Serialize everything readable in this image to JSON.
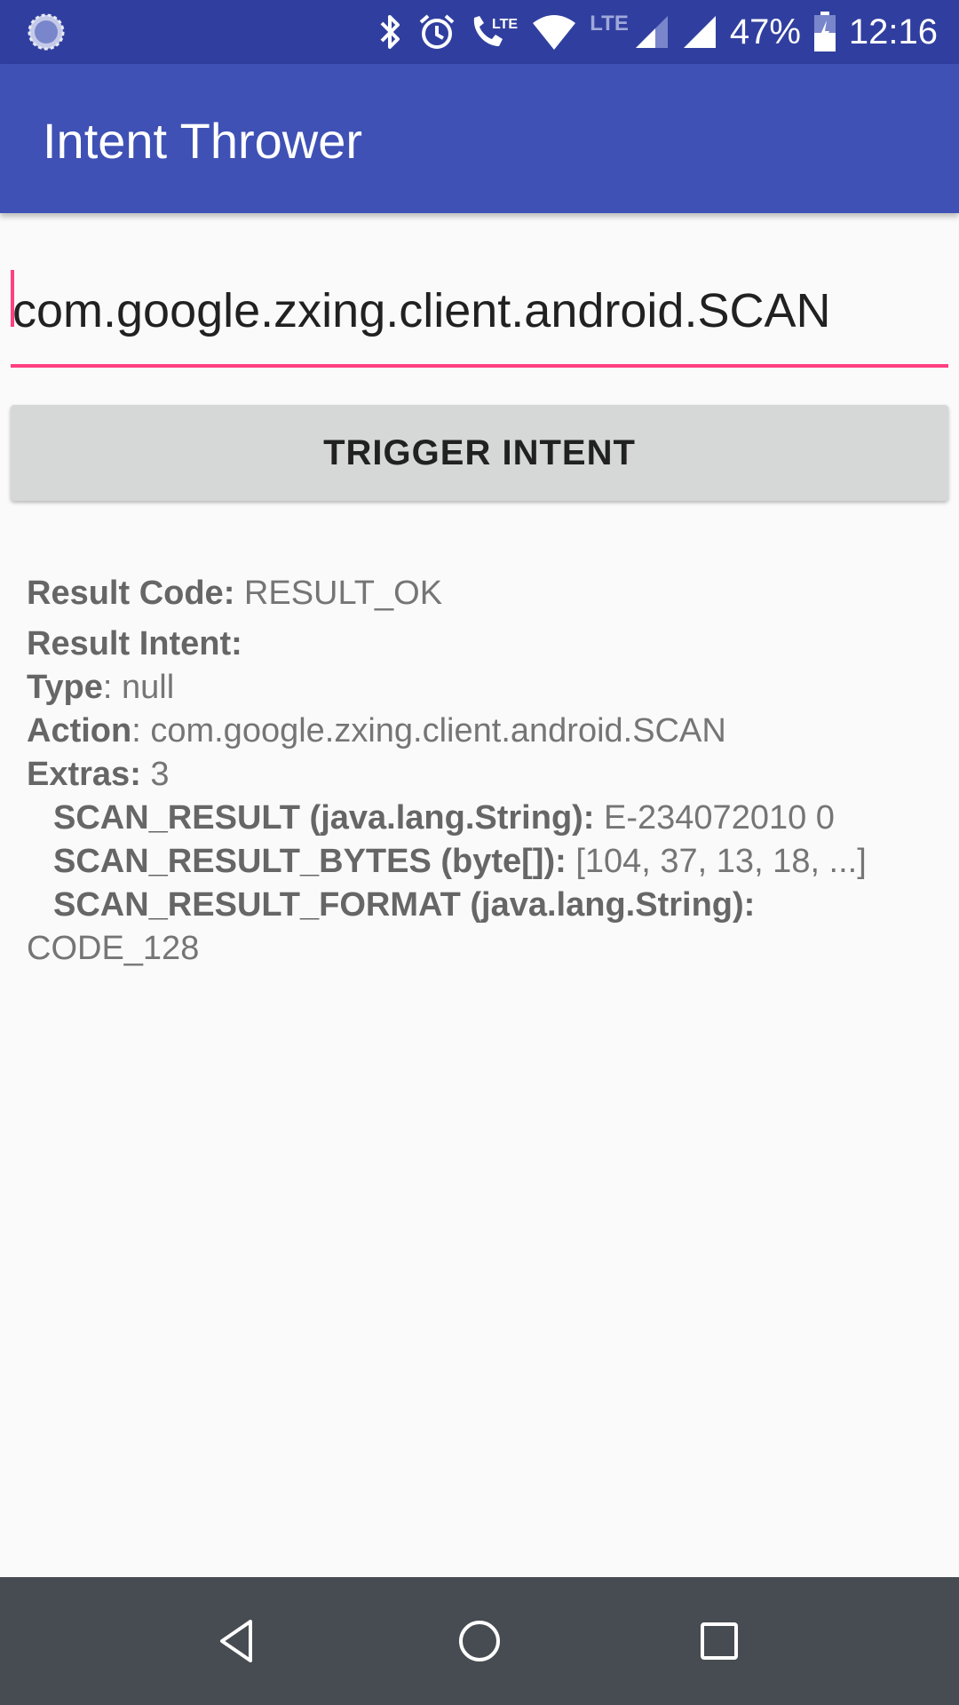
{
  "status_bar": {
    "battery": "47%",
    "time": "12:16",
    "lte_label": "LTE",
    "icons": [
      "sync-icon",
      "bluetooth-icon",
      "alarm-icon",
      "volte-call-icon",
      "wifi-icon",
      "signal-icon",
      "signal-icon",
      "battery-icon"
    ]
  },
  "app_bar": {
    "title": "Intent Thrower"
  },
  "intent_input": {
    "value": "com.google.zxing.client.android.SCAN"
  },
  "trigger_button": {
    "label": "TRIGGER INTENT"
  },
  "result": {
    "code_label": "Result Code:",
    "code_value": " RESULT_OK",
    "intent_label": "Result Intent:",
    "type_label": "Type",
    "type_value": ": null",
    "action_label": "Action",
    "action_value": ": com.google.zxing.client.android.SCAN",
    "extras_label": "Extras:",
    "extras_value": " 3",
    "extras": [
      {
        "key": "SCAN_RESULT (java.lang.String):",
        "value": " E-234072010 0"
      },
      {
        "key": "SCAN_RESULT_BYTES (byte[]):",
        "value": " [104, 37, 13, 18, ...]"
      },
      {
        "key": "SCAN_RESULT_FORMAT (java.lang.String):",
        "value": "CODE_128"
      }
    ]
  },
  "nav_bar": {
    "icons": [
      "back-icon",
      "home-icon",
      "recents-icon"
    ]
  },
  "colors": {
    "status_bar": "#303f9f",
    "app_bar": "#3f51b5",
    "accent": "#ff4081",
    "nav_bar": "#474c52"
  }
}
